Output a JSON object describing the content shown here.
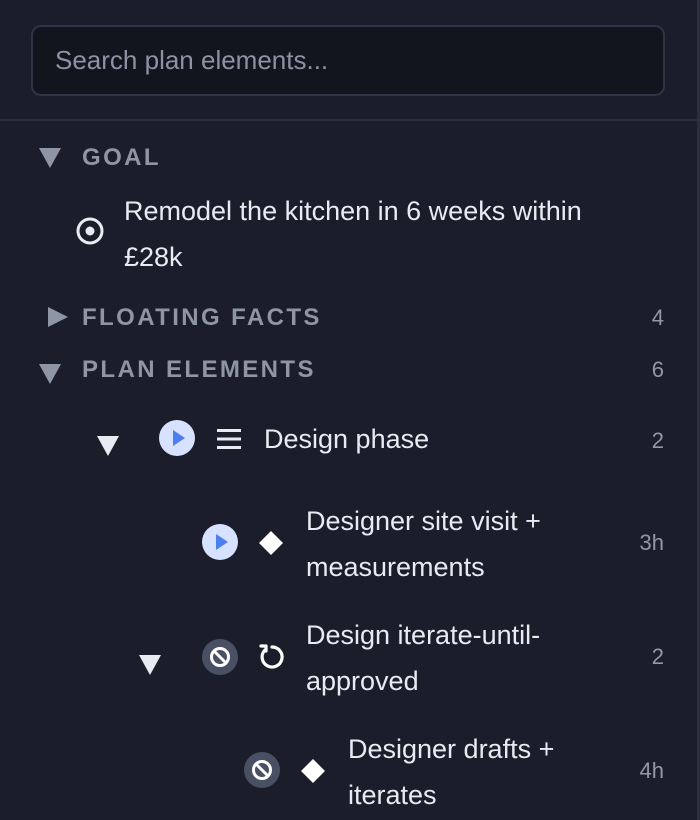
{
  "search": {
    "placeholder": "Search plan elements..."
  },
  "goal": {
    "section_label": "GOAL",
    "text": "Remodel the kitchen in 6 weeks within £28k",
    "icon": "target-icon"
  },
  "floating_facts": {
    "section_label": "FLOATING FACTS",
    "count": "4",
    "expanded": false
  },
  "plan_elements": {
    "section_label": "PLAN ELEMENTS",
    "count": "6",
    "expanded": true,
    "items": [
      {
        "label": "Design phase",
        "meta": "2",
        "status": "active",
        "kind": "sequence-icon",
        "expanded": true,
        "depth": 1
      },
      {
        "label": "Designer site visit + measurements",
        "meta": "3h",
        "status": "active",
        "kind": "task-diamond-icon",
        "depth": 2
      },
      {
        "label": "Design iterate-until-approved",
        "meta": "2",
        "status": "blocked",
        "kind": "loop-icon",
        "expanded": true,
        "depth": 2
      },
      {
        "label": "Designer drafts + iterates",
        "meta": "4h",
        "status": "blocked",
        "kind": "task-diamond-icon",
        "depth": 3
      }
    ]
  },
  "colors": {
    "background": "#1b1e2a",
    "active_status": "#4d7ef0",
    "active_status_bg": "#d6e2ff",
    "blocked_status_bg": "#4a5064",
    "muted_text": "#8f95a4"
  }
}
